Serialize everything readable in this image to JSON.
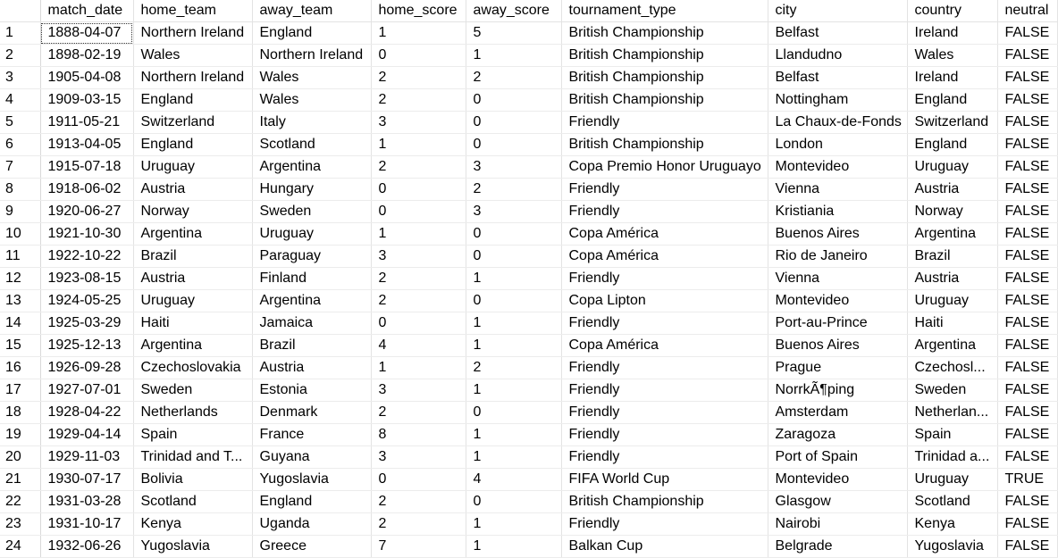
{
  "grid": {
    "columns": [
      "match_date",
      "home_team",
      "away_team",
      "home_score",
      "away_score",
      "tournament_type",
      "city",
      "country",
      "neutral"
    ],
    "rows": [
      [
        "1",
        "1888-04-07",
        "Northern Ireland",
        "England",
        "1",
        "5",
        "British Championship",
        "Belfast",
        "Ireland",
        "FALSE"
      ],
      [
        "2",
        "1898-02-19",
        "Wales",
        "Northern Ireland",
        "0",
        "1",
        "British Championship",
        "Llandudno",
        "Wales",
        "FALSE"
      ],
      [
        "3",
        "1905-04-08",
        "Northern Ireland",
        "Wales",
        "2",
        "2",
        "British Championship",
        "Belfast",
        "Ireland",
        "FALSE"
      ],
      [
        "4",
        "1909-03-15",
        "England",
        "Wales",
        "2",
        "0",
        "British Championship",
        "Nottingham",
        "England",
        "FALSE"
      ],
      [
        "5",
        "1911-05-21",
        "Switzerland",
        "Italy",
        "3",
        "0",
        "Friendly",
        "La Chaux-de-Fonds",
        "Switzerland",
        "FALSE"
      ],
      [
        "6",
        "1913-04-05",
        "England",
        "Scotland",
        "1",
        "0",
        "British Championship",
        "London",
        "England",
        "FALSE"
      ],
      [
        "7",
        "1915-07-18",
        "Uruguay",
        "Argentina",
        "2",
        "3",
        "Copa Premio Honor Uruguayo",
        "Montevideo",
        "Uruguay",
        "FALSE"
      ],
      [
        "8",
        "1918-06-02",
        "Austria",
        "Hungary",
        "0",
        "2",
        "Friendly",
        "Vienna",
        "Austria",
        "FALSE"
      ],
      [
        "9",
        "1920-06-27",
        "Norway",
        "Sweden",
        "0",
        "3",
        "Friendly",
        "Kristiania",
        "Norway",
        "FALSE"
      ],
      [
        "10",
        "1921-10-30",
        "Argentina",
        "Uruguay",
        "1",
        "0",
        "Copa América",
        "Buenos Aires",
        "Argentina",
        "FALSE"
      ],
      [
        "11",
        "1922-10-22",
        "Brazil",
        "Paraguay",
        "3",
        "0",
        "Copa América",
        "Rio de Janeiro",
        "Brazil",
        "FALSE"
      ],
      [
        "12",
        "1923-08-15",
        "Austria",
        "Finland",
        "2",
        "1",
        "Friendly",
        "Vienna",
        "Austria",
        "FALSE"
      ],
      [
        "13",
        "1924-05-25",
        "Uruguay",
        "Argentina",
        "2",
        "0",
        "Copa Lipton",
        "Montevideo",
        "Uruguay",
        "FALSE"
      ],
      [
        "14",
        "1925-03-29",
        "Haiti",
        "Jamaica",
        "0",
        "1",
        "Friendly",
        "Port-au-Prince",
        "Haiti",
        "FALSE"
      ],
      [
        "15",
        "1925-12-13",
        "Argentina",
        "Brazil",
        "4",
        "1",
        "Copa América",
        "Buenos Aires",
        "Argentina",
        "FALSE"
      ],
      [
        "16",
        "1926-09-28",
        "Czechoslovakia",
        "Austria",
        "1",
        "2",
        "Friendly",
        "Prague",
        "Czechosl...",
        "FALSE"
      ],
      [
        "17",
        "1927-07-01",
        "Sweden",
        "Estonia",
        "3",
        "1",
        "Friendly",
        "NorrkÃ¶ping",
        "Sweden",
        "FALSE"
      ],
      [
        "18",
        "1928-04-22",
        "Netherlands",
        "Denmark",
        "2",
        "0",
        "Friendly",
        "Amsterdam",
        "Netherlan...",
        "FALSE"
      ],
      [
        "19",
        "1929-04-14",
        "Spain",
        "France",
        "8",
        "1",
        "Friendly",
        "Zaragoza",
        "Spain",
        "FALSE"
      ],
      [
        "20",
        "1929-11-03",
        "Trinidad and T...",
        "Guyana",
        "3",
        "1",
        "Friendly",
        "Port of Spain",
        "Trinidad a...",
        "FALSE"
      ],
      [
        "21",
        "1930-07-17",
        "Bolivia",
        "Yugoslavia",
        "0",
        "4",
        "FIFA World Cup",
        "Montevideo",
        "Uruguay",
        "TRUE"
      ],
      [
        "22",
        "1931-03-28",
        "Scotland",
        "England",
        "2",
        "0",
        "British Championship",
        "Glasgow",
        "Scotland",
        "FALSE"
      ],
      [
        "23",
        "1931-10-17",
        "Kenya",
        "Uganda",
        "2",
        "1",
        "Friendly",
        "Nairobi",
        "Kenya",
        "FALSE"
      ],
      [
        "24",
        "1932-06-26",
        "Yugoslavia",
        "Greece",
        "7",
        "1",
        "Balkan Cup",
        "Belgrade",
        "Yugoslavia",
        "FALSE"
      ]
    ],
    "selected_row": 0,
    "selected_col": 1
  }
}
